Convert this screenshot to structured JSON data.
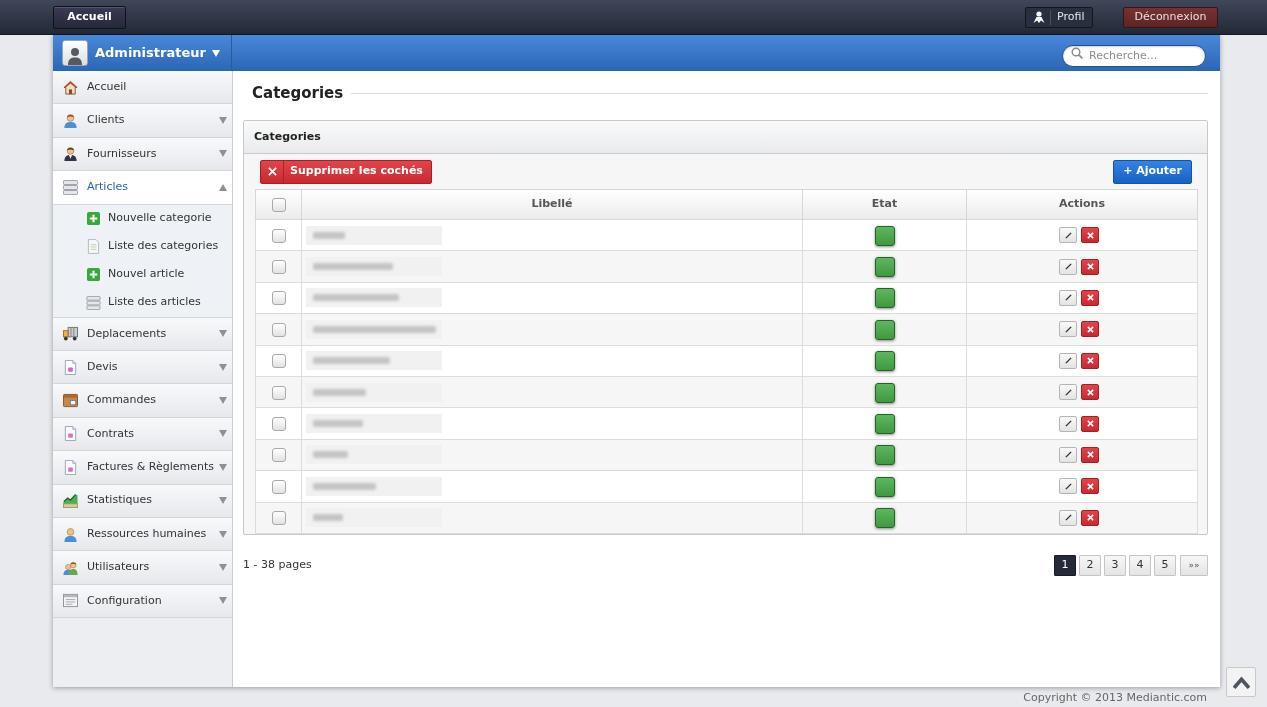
{
  "top_bar": {
    "home_button": "Accueil",
    "profile_button": "Profil",
    "logout_button": "Déconnexion"
  },
  "header": {
    "user_name": "Administrateur",
    "search": {
      "placeholder": "Recherche..."
    }
  },
  "sidebar": {
    "items": [
      {
        "kind": "link",
        "label": "Accueil",
        "selected": false
      },
      {
        "kind": "group",
        "label": "Clients",
        "selected": false,
        "expanded": false
      },
      {
        "kind": "group",
        "label": "Fournisseurs",
        "selected": false,
        "expanded": false
      },
      {
        "kind": "group",
        "label": "Articles",
        "selected": true,
        "expanded": true,
        "children": [
          {
            "label": "Nouvelle categorie"
          },
          {
            "label": "Liste des categories"
          },
          {
            "label": "Nouvel article"
          },
          {
            "label": "Liste des articles"
          }
        ]
      },
      {
        "kind": "group",
        "label": "Deplacements",
        "selected": false,
        "expanded": false
      },
      {
        "kind": "group",
        "label": "Devis",
        "selected": false,
        "expanded": false
      },
      {
        "kind": "group",
        "label": "Commandes",
        "selected": false,
        "expanded": false
      },
      {
        "kind": "group",
        "label": "Contrats",
        "selected": false,
        "expanded": false
      },
      {
        "kind": "group",
        "label": "Factures & Règlements",
        "selected": false,
        "expanded": false
      },
      {
        "kind": "group",
        "label": "Statistiques",
        "selected": false,
        "expanded": false
      },
      {
        "kind": "group",
        "label": "Ressources humaines",
        "selected": false,
        "expanded": false
      },
      {
        "kind": "group",
        "label": "Utilisateurs",
        "selected": false,
        "expanded": false
      },
      {
        "kind": "group",
        "label": "Configuration",
        "selected": false,
        "expanded": false
      }
    ]
  },
  "page_title": "Categories",
  "panel": {
    "title": "Categories",
    "delete_checked_button": "Supprimer les cochés",
    "add_button": "+ Ajouter",
    "table": {
      "header_checkbox": {
        "checked": false
      },
      "columns": [
        "Libellé",
        "Etat",
        "Actions"
      ],
      "rows": [
        {
          "checked": false,
          "active": true
        },
        {
          "checked": false,
          "active": true
        },
        {
          "checked": false,
          "active": true
        },
        {
          "checked": false,
          "active": true
        },
        {
          "checked": false,
          "active": true
        },
        {
          "checked": false,
          "active": true
        },
        {
          "checked": false,
          "active": true
        },
        {
          "checked": false,
          "active": true
        },
        {
          "checked": false,
          "active": true
        },
        {
          "checked": false,
          "active": true
        }
      ]
    }
  },
  "pagination": {
    "summary": "1 - 38 pages",
    "pages": [
      {
        "label": "1",
        "selected": true
      },
      {
        "label": "2",
        "selected": false
      },
      {
        "label": "3",
        "selected": false
      },
      {
        "label": "4",
        "selected": false
      },
      {
        "label": "5",
        "selected": false
      }
    ],
    "last_button": "»»"
  },
  "footer": {
    "copyright": "Copyright © 2013 Mediantic.com"
  }
}
